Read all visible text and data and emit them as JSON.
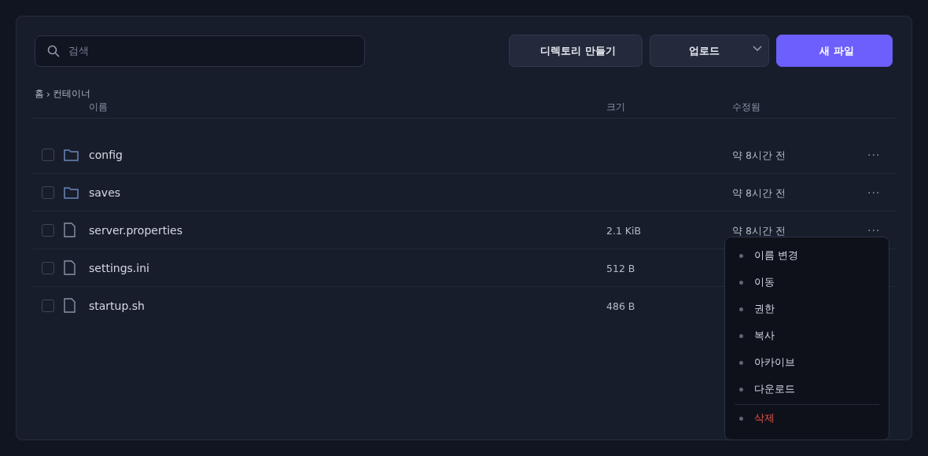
{
  "search": {
    "placeholder": "검색"
  },
  "buttons": [
    {
      "label": "디렉토리 만들기",
      "kind": "secondary"
    },
    {
      "label": "업로드",
      "kind": "dropdown"
    },
    {
      "label": "새 파일",
      "kind": "primary"
    }
  ],
  "breadcrumb": [
    {
      "label": "홈"
    },
    {
      "label": "컨테이너"
    }
  ],
  "breadcrumb_separator": "›",
  "columns": [
    "이름",
    "크기",
    "수정됨"
  ],
  "rows": [
    {
      "kind": "folder",
      "name": "config",
      "checked": false,
      "modified": "약 8시간 전",
      "more": "···"
    },
    {
      "kind": "folder",
      "name": "saves",
      "checked": false,
      "modified": "약 8시간 전",
      "more": "···"
    },
    {
      "kind": "file",
      "name": "server.properties",
      "checked": false,
      "size": "2.1 KiB",
      "modified": "약 8시간 전",
      "more": "···"
    },
    {
      "kind": "file",
      "name": "settings.ini",
      "checked": false,
      "size": "512 B"
    },
    {
      "kind": "file",
      "name": "startup.sh",
      "checked": false,
      "size": "486 B"
    }
  ],
  "menu": [
    {
      "label": "이름 변경",
      "kind": "normal"
    },
    {
      "label": "이동",
      "kind": "normal"
    },
    {
      "label": "권한",
      "kind": "normal"
    },
    {
      "label": "복사",
      "kind": "normal"
    },
    {
      "label": "아카이브",
      "kind": "normal"
    },
    {
      "label": "다운로드",
      "kind": "normal"
    },
    {
      "label": "삭제",
      "kind": "danger"
    }
  ]
}
